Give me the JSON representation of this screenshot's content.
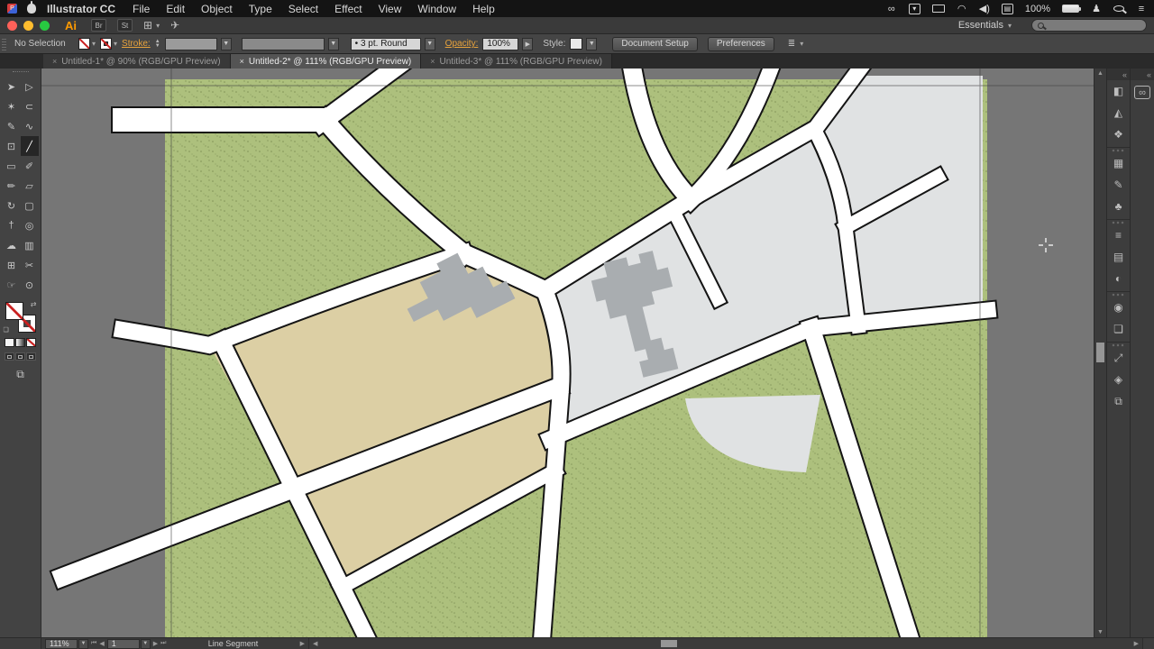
{
  "menubar": {
    "app_badge": "P",
    "app_name": "Illustrator CC",
    "items": [
      "File",
      "Edit",
      "Object",
      "Type",
      "Select",
      "Effect",
      "View",
      "Window",
      "Help"
    ],
    "battery_percent": "100%",
    "status_icons": {
      "creative_cloud": "∞",
      "box_sync": "▾",
      "volume": "◀)",
      "input_source": "▤",
      "user": "♟",
      "notification_center": "≡"
    }
  },
  "appbar": {
    "logo": "Ai",
    "bridge_button": "Br",
    "stock_button": "St",
    "arrange_glyph": "⊞",
    "gpu_glyph": "✈",
    "caret": "▾",
    "workspace": "Essentials"
  },
  "controlbar": {
    "selection_status": "No Selection",
    "stroke_label": "Stroke:",
    "brush_value": "• 3 pt. Round",
    "opacity_label": "Opacity:",
    "opacity_value": "100%",
    "style_label": "Style:",
    "doc_setup_button": "Document Setup",
    "preferences_button": "Preferences",
    "panel_menu_glyph": "≣"
  },
  "tabs": [
    {
      "close": "×",
      "label": "Untitled-1* @ 90% (RGB/GPU Preview)"
    },
    {
      "close": "×",
      "label": "Untitled-2* @ 111% (RGB/GPU Preview)"
    },
    {
      "close": "×",
      "label": "Untitled-3* @ 111% (RGB/GPU Preview)"
    }
  ],
  "toolbar": {
    "tools": [
      {
        "name": "selection",
        "glyph": "➤"
      },
      {
        "name": "direct-selection",
        "glyph": "▷"
      },
      {
        "name": "magic-wand",
        "glyph": "✶"
      },
      {
        "name": "lasso",
        "glyph": "⊂"
      },
      {
        "name": "pen",
        "glyph": "✎"
      },
      {
        "name": "curvature",
        "glyph": "∿"
      },
      {
        "name": "type",
        "glyph": "⊡"
      },
      {
        "name": "line-segment",
        "glyph": "╱"
      },
      {
        "name": "rectangle",
        "glyph": "▭"
      },
      {
        "name": "paintbrush",
        "glyph": "✐"
      },
      {
        "name": "pencil",
        "glyph": "✏"
      },
      {
        "name": "eraser",
        "glyph": "▱"
      },
      {
        "name": "rotate",
        "glyph": "↻"
      },
      {
        "name": "free-transform",
        "glyph": "▢"
      },
      {
        "name": "eyedropper",
        "glyph": "†"
      },
      {
        "name": "blend",
        "glyph": "◎"
      },
      {
        "name": "symbol-sprayer",
        "glyph": "☁"
      },
      {
        "name": "column-graph",
        "glyph": "▥"
      },
      {
        "name": "artboard",
        "glyph": "⊞"
      },
      {
        "name": "slice",
        "glyph": "✂"
      },
      {
        "name": "hand",
        "glyph": "☞"
      },
      {
        "name": "zoom",
        "glyph": "⊙"
      }
    ]
  },
  "panels": {
    "collapse_glyph": "«",
    "cc_glyph": "∞",
    "icons": [
      {
        "name": "color",
        "glyph": "◧"
      },
      {
        "name": "color-guide",
        "glyph": "◭"
      },
      {
        "name": "recolor-artwork",
        "glyph": "❖"
      },
      {
        "name": "swatches",
        "glyph": "▦"
      },
      {
        "name": "brushes",
        "glyph": "✎"
      },
      {
        "name": "symbols",
        "glyph": "♣"
      },
      {
        "name": "stroke",
        "glyph": "≡"
      },
      {
        "name": "gradient",
        "glyph": "▤"
      },
      {
        "name": "transparency",
        "glyph": "◐"
      },
      {
        "name": "appearance",
        "glyph": "◉"
      },
      {
        "name": "graphic-styles",
        "glyph": "❏"
      },
      {
        "name": "export",
        "glyph": "⤢"
      },
      {
        "name": "layers",
        "glyph": "◈"
      },
      {
        "name": "artboards",
        "glyph": "⧉"
      }
    ]
  },
  "statusbar": {
    "zoom": "111%",
    "artboard_number": "1",
    "status_text": "Line Segment"
  },
  "canvas": {
    "colors": {
      "pasteboard": "#767676",
      "artboard_green": "#adc07d",
      "parcel_beige": "#dccfa4",
      "parcel_gray": "#e0e2e3",
      "building": "#a9adb0",
      "road_fill": "#ffffff",
      "road_outline": "#141414",
      "hairline": "#3f3f3f"
    }
  }
}
